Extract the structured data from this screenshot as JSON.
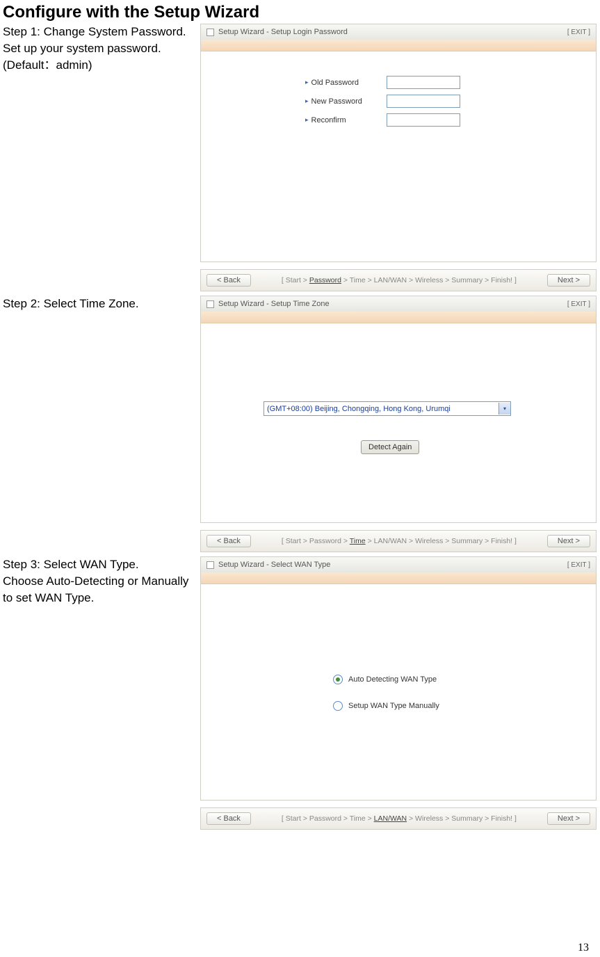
{
  "page_title": "Configure with the Setup Wizard",
  "page_number": "13",
  "steps": {
    "step1": {
      "heading": "Step 1: Change System Password.",
      "desc1": "Set up your system password.",
      "desc2": "(Default：admin)"
    },
    "step2": {
      "heading": "Step 2: Select Time Zone."
    },
    "step3": {
      "heading": "Step 3: Select WAN Type.",
      "desc1": "Choose Auto-Detecting or Manually to set WAN Type."
    }
  },
  "panel1": {
    "title": "Setup Wizard - Setup Login Password",
    "exit": "[ EXIT ]",
    "fields": {
      "old": "Old Password",
      "new": "New Password",
      "reconfirm": "Reconfirm"
    },
    "back": "< Back",
    "next": "Next >",
    "crumb_prefix": "[ Start > ",
    "crumb_active": "Password",
    "crumb_suffix": " > Time > LAN/WAN > Wireless > Summary > Finish! ]"
  },
  "panel2": {
    "title": "Setup Wizard - Setup Time Zone",
    "exit": "[ EXIT ]",
    "select_value": "(GMT+08:00) Beijing, Chongqing, Hong Kong, Urumqi",
    "detect": "Detect Again",
    "back": "< Back",
    "next": "Next >",
    "crumb_prefix": "[ Start > Password > ",
    "crumb_active": "Time",
    "crumb_suffix": " > LAN/WAN > Wireless > Summary > Finish! ]"
  },
  "panel3": {
    "title": "Setup Wizard - Select WAN Type",
    "exit": "[ EXIT ]",
    "opt_auto": "Auto Detecting WAN Type",
    "opt_manual": "Setup WAN Type Manually",
    "back": "< Back",
    "next": "Next >",
    "crumb_prefix": "[ Start > Password > Time > ",
    "crumb_active": "LAN/WAN",
    "crumb_suffix": " > Wireless > Summary > Finish! ]"
  }
}
